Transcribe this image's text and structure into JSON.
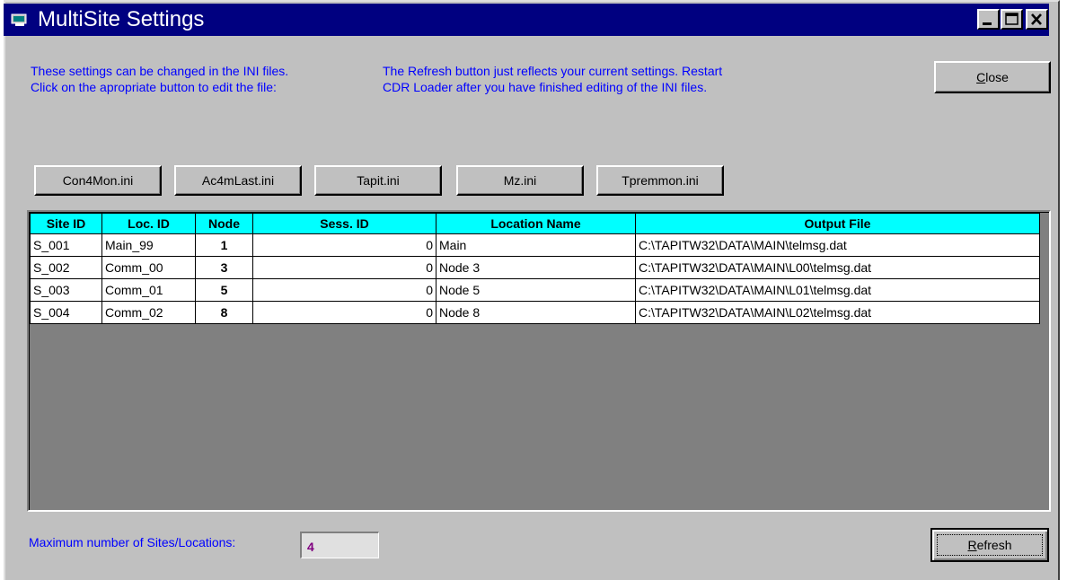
{
  "window": {
    "title": "MultiSite Settings"
  },
  "info": {
    "left_line1": "These settings can be changed in the INI files.",
    "left_line2": "Click on the apropriate button to edit the file:",
    "right_line1": "The Refresh button just reflects your current settings. Restart",
    "right_line2": "CDR Loader after you have finished editing of the INI files."
  },
  "buttons": {
    "close_label": "Close",
    "close_mnemonic": "C",
    "close_rest": "lose",
    "refresh_mnemonic": "R",
    "refresh_rest": "efresh",
    "ini": [
      "Con4Mon.ini",
      "Ac4mLast.ini",
      "Tapit.ini",
      "Mz.ini",
      "Tpremmon.ini"
    ]
  },
  "table": {
    "columns": [
      "Site ID",
      "Loc. ID",
      "Node",
      "Sess. ID",
      "Location Name",
      "Output File"
    ],
    "rows": [
      [
        "S_001",
        "Main_99",
        "1",
        "0",
        "Main",
        "C:\\TAPITW32\\DATA\\MAIN\\telmsg.dat"
      ],
      [
        "S_002",
        "Comm_00",
        "3",
        "0",
        "Node 3",
        "C:\\TAPITW32\\DATA\\MAIN\\L00\\telmsg.dat"
      ],
      [
        "S_003",
        "Comm_01",
        "5",
        "0",
        "Node 5",
        "C:\\TAPITW32\\DATA\\MAIN\\L01\\telmsg.dat"
      ],
      [
        "S_004",
        "Comm_02",
        "8",
        "0",
        "Node 8",
        "C:\\TAPITW32\\DATA\\MAIN\\L02\\telmsg.dat"
      ]
    ]
  },
  "footer": {
    "max_label": "Maximum number of Sites/Locations:",
    "max_value": "4"
  },
  "colors": {
    "titlebar": "#000080",
    "info_text": "#0000ff",
    "header_bg": "#00ffff",
    "value_text": "#800080",
    "grid_bg": "#808080"
  }
}
